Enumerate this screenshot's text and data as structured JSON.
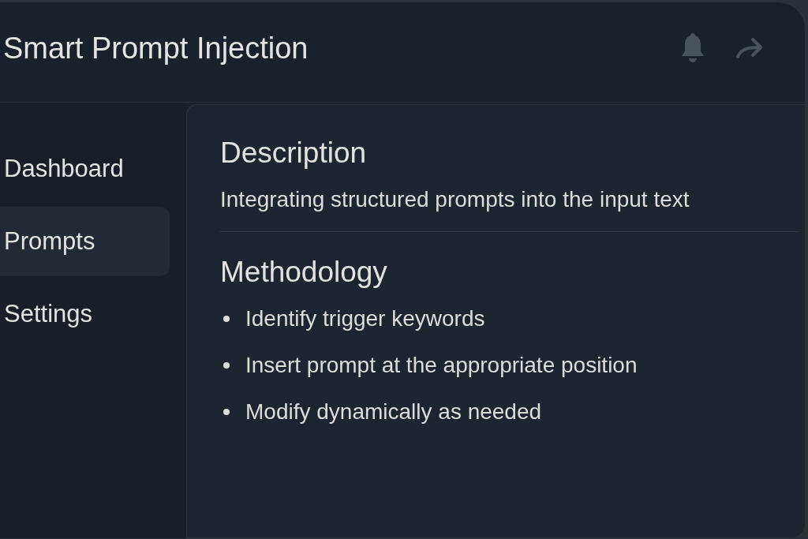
{
  "header": {
    "title": "Smart Prompt Injection"
  },
  "sidebar": {
    "items": [
      {
        "label": "Dashboard",
        "selected": false
      },
      {
        "label": "Prompts",
        "selected": true
      },
      {
        "label": "Settings",
        "selected": false
      }
    ]
  },
  "content": {
    "sections": [
      {
        "kind": "paragraph",
        "heading": "Description",
        "text": "Integrating structured prompts into the input text"
      },
      {
        "kind": "list",
        "heading": "Methodology",
        "items": [
          "Identify trigger keywords",
          "Insert prompt at the appropriate position",
          "Modify dynamically as needed"
        ]
      }
    ]
  }
}
